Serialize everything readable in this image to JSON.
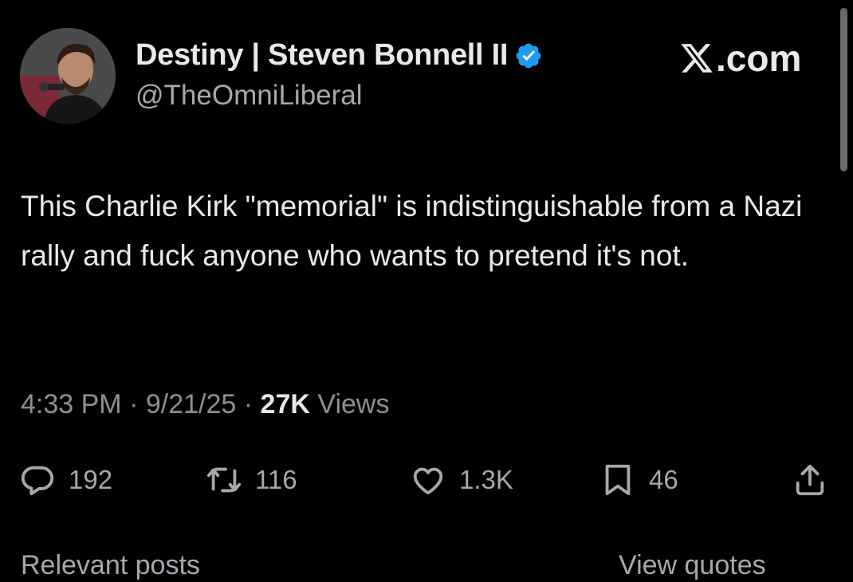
{
  "author": {
    "display_name": "Destiny | Steven Bonnell II",
    "handle": "@TheOmniLiberal",
    "verified": true,
    "verified_color": "#1d9bf0"
  },
  "brand": {
    "label": ".com",
    "icon": "x-logo-icon"
  },
  "tweet": {
    "text": "This Charlie Kirk \"memorial\" is indistinguishable from a Nazi rally and fuck anyone who wants to pretend it's not."
  },
  "meta": {
    "time": "4:33 PM",
    "date": "9/21/25",
    "separator": "·",
    "views_count": "27K",
    "views_label": "Views"
  },
  "actions": {
    "replies": {
      "icon": "reply-icon",
      "count": "192"
    },
    "reposts": {
      "icon": "repost-icon",
      "count": "116"
    },
    "likes": {
      "icon": "heart-icon",
      "count": "1.3K"
    },
    "bookmarks": {
      "icon": "bookmark-icon",
      "count": "46"
    },
    "share": {
      "icon": "share-icon"
    }
  },
  "footer": {
    "left_label": "Relevant posts",
    "right_label": "View quotes"
  },
  "colors": {
    "background": "#000000",
    "text_primary": "#e7e9ea",
    "text_secondary": "#8b9096"
  }
}
